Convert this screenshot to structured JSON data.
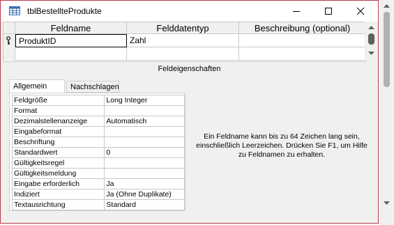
{
  "window": {
    "title": "tblBestellteProdukte"
  },
  "grid": {
    "columns": [
      "Feldname",
      "Felddatentyp",
      "Beschreibung (optional)"
    ],
    "rows": [
      {
        "name": "ProduktID",
        "type": "Zahl",
        "description": ""
      }
    ]
  },
  "section_label": "Feldeigenschaften",
  "tabs": [
    "Allgemein",
    "Nachschlagen"
  ],
  "properties": [
    {
      "key": "Feldgröße",
      "value": "Long Integer"
    },
    {
      "key": "Format",
      "value": ""
    },
    {
      "key": "Dezimalstellenanzeige",
      "value": "Automatisch"
    },
    {
      "key": "Eingabeformat",
      "value": ""
    },
    {
      "key": "Beschriftung",
      "value": ""
    },
    {
      "key": "Standardwert",
      "value": "0"
    },
    {
      "key": "Gültigkeitsregel",
      "value": ""
    },
    {
      "key": "Gültigkeitsmeldung",
      "value": ""
    },
    {
      "key": "Eingabe erforderlich",
      "value": "Ja"
    },
    {
      "key": "Indiziert",
      "value": "Ja (Ohne Duplikate)"
    },
    {
      "key": "Textausrichtung",
      "value": "Standard"
    }
  ],
  "help_text": "Ein Feldname kann bis zu 64 Zeichen lang sein, einschließlich Leerzeichen. Drücken Sie F1, um Hilfe zu Feldnamen zu erhalten.",
  "icons": {
    "table": "table-icon",
    "minimize": "minimize-icon",
    "maximize": "maximize-icon",
    "close": "close-icon",
    "key": "primary-key-icon"
  },
  "colors": {
    "window_border": "#b83a4a"
  }
}
